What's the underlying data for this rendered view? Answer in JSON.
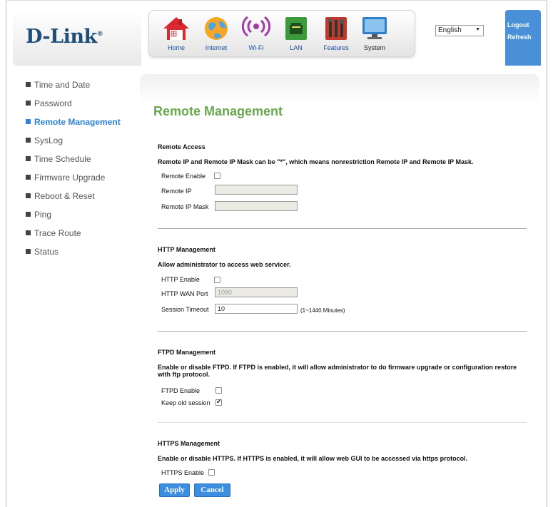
{
  "header": {
    "logo": "D-Link",
    "logo_mark": "®",
    "nav": [
      {
        "label": "Home",
        "icon": "home-icon"
      },
      {
        "label": "Internet",
        "icon": "globe-icon"
      },
      {
        "label": "Wi-Fi",
        "icon": "wifi-icon"
      },
      {
        "label": "LAN",
        "icon": "lan-icon"
      },
      {
        "label": "Features",
        "icon": "tools-icon"
      },
      {
        "label": "System",
        "icon": "monitor-icon"
      }
    ],
    "language": "English",
    "logout": "Logout",
    "refresh": "Refresh"
  },
  "sidebar": {
    "items": [
      {
        "label": "Time and Date"
      },
      {
        "label": "Password"
      },
      {
        "label": "Remote Management"
      },
      {
        "label": "SysLog"
      },
      {
        "label": "Time Schedule"
      },
      {
        "label": "Firmware Upgrade"
      },
      {
        "label": "Reboot & Reset"
      },
      {
        "label": "Ping"
      },
      {
        "label": "Trace Route"
      },
      {
        "label": "Status"
      }
    ],
    "active_index": 2
  },
  "main": {
    "title": "Remote Management",
    "remote_access": {
      "title": "Remote Access",
      "desc": "Remote IP and Remote IP Mask can be \"*\", which means nonrestriction Remote IP and Remote IP Mask.",
      "enable_label": "Remote Enable",
      "enable_checked": false,
      "ip_label": "Remote IP",
      "ip_value": "",
      "mask_label": "Remote IP Mask",
      "mask_value": ""
    },
    "http": {
      "title": "HTTP Management",
      "desc": "Allow administrator to access web servicer.",
      "enable_label": "HTTP Enable",
      "enable_checked": false,
      "port_label": "HTTP WAN Port",
      "port_value": "1080",
      "timeout_label": "Session Timeout",
      "timeout_value": "10",
      "timeout_hint": "(1~1440 Minutes)"
    },
    "ftpd": {
      "title": "FTPD Management",
      "desc": "Enable or disable FTPD. If FTPD is enabled, it will allow administrator to do firmware upgrade or configuration restore with ftp protocol.",
      "enable_label": "FTPD Enable",
      "enable_checked": false,
      "keep_label": "Keep old session",
      "keep_checked": true
    },
    "https": {
      "title": "HTTPS Management",
      "desc": "Enable or disable HTTPS. If HTTPS is enabled, it will allow web GUI to be accessed via https protocol.",
      "enable_label": "HTTPS Enable",
      "enable_checked": false
    },
    "apply_label": "Apply",
    "cancel_label": "Cancel"
  },
  "colors": {
    "title_green": "#6aa84f",
    "accent_blue": "#2f82d6",
    "button_blue": "#3b8ee0",
    "logo_blue": "#1f4e79"
  }
}
